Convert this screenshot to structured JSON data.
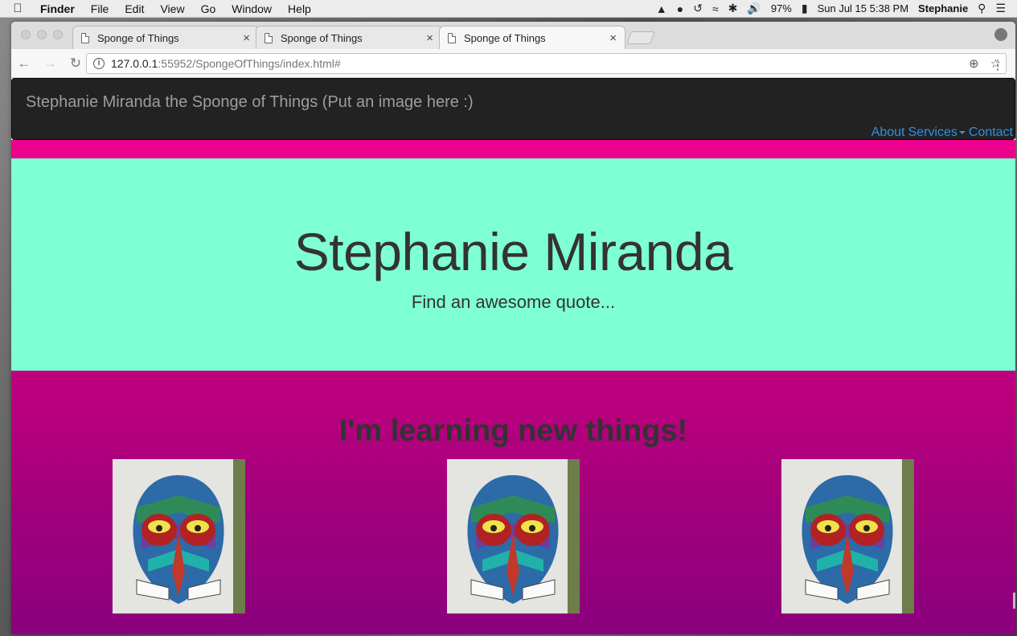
{
  "menubar": {
    "apple_icon": "apple-icon",
    "app_name": "Finder",
    "items": [
      "File",
      "Edit",
      "View",
      "Go",
      "Window",
      "Help"
    ],
    "battery": "97%",
    "datetime": "Sun Jul 15  5:38 PM",
    "user": "Stephanie"
  },
  "browser": {
    "tabs": [
      {
        "title": "Sponge of Things"
      },
      {
        "title": "Sponge of Things"
      },
      {
        "title": "Sponge of Things"
      }
    ],
    "url_host": "127.0.0.1",
    "url_path": ":55952/SpongeOfThings/index.html#"
  },
  "page": {
    "brand": "Stephanie Miranda the Sponge of Things (Put an image here :)",
    "nav": {
      "about": "About",
      "services": "Services",
      "contact": "Contact"
    },
    "hero": {
      "title": "Stephanie Miranda",
      "subtitle": "Find an awesome quote..."
    },
    "section": {
      "heading": "I'm learning new things!",
      "images": [
        "owl-mural-image",
        "owl-mural-image",
        "owl-mural-image"
      ]
    }
  },
  "colors": {
    "navbar": "#222222",
    "pink_strip": "#ec008c",
    "hero_bg": "#7fffd4",
    "section_top": "#c0007e",
    "section_bottom": "#8a007d",
    "link": "#3390e0"
  }
}
